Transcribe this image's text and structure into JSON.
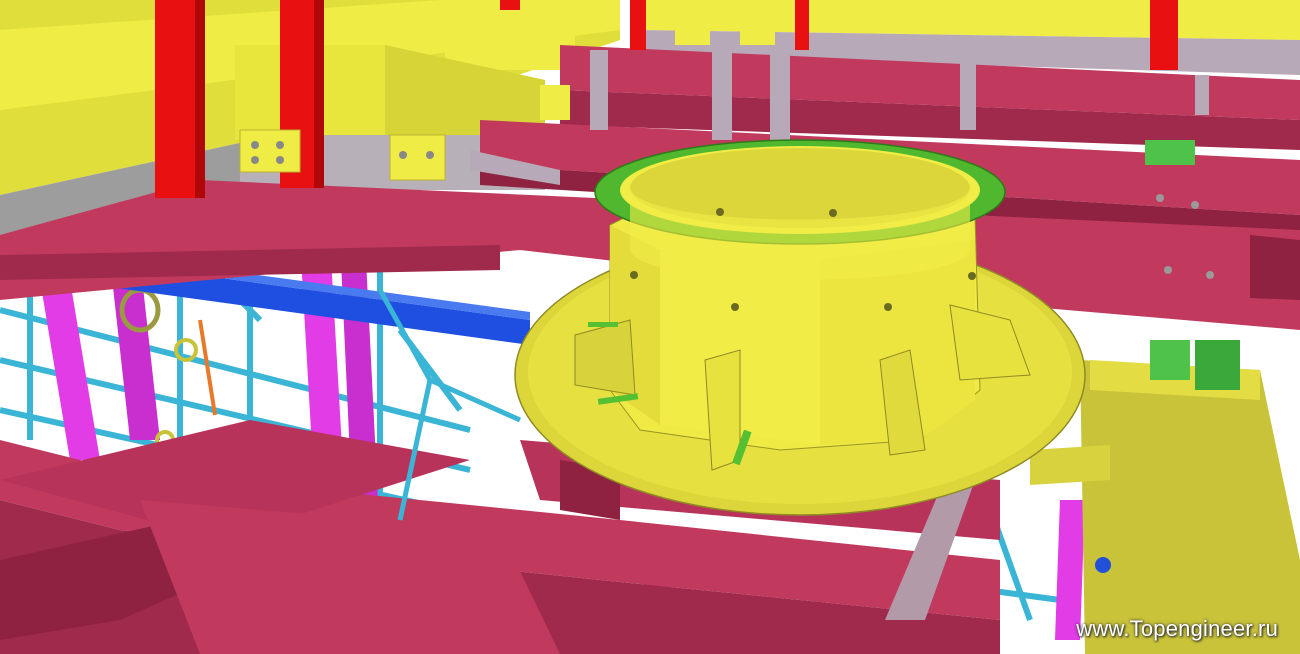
{
  "watermark": {
    "text": "www.Topengineer.ru"
  },
  "palette": {
    "beam": "#c13a5e",
    "beam_dark": "#8e2240",
    "yellow": "#e8e83a",
    "olive": "#c9c33a",
    "green_ring": "#55c032",
    "magenta": "#e23ce6",
    "cyan": "#3ab5d6",
    "blue": "#1f4fe0",
    "red": "#e81010",
    "grey": "#b8a9b8"
  }
}
